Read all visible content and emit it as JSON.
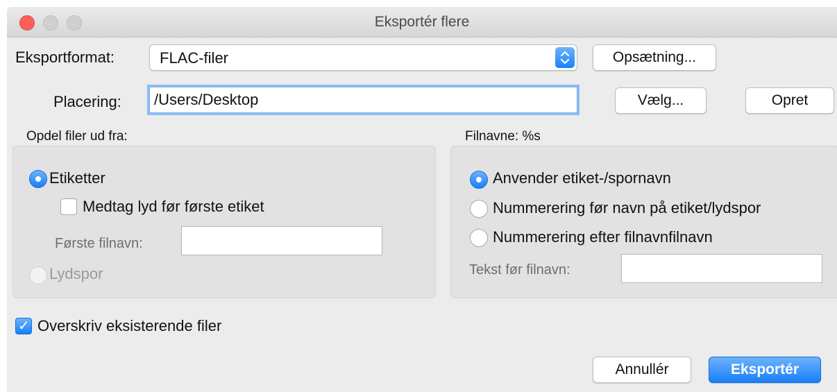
{
  "window": {
    "title": "Eksportér flere"
  },
  "format": {
    "label": "Eksportformat:",
    "value": "FLAC-filer",
    "setup_button": "Opsætning..."
  },
  "location": {
    "label": "Placering:",
    "value": "/Users/Desktop",
    "choose_button": "Vælg...",
    "create_button": "Opret"
  },
  "split": {
    "heading": "Opdel filer ud fra:",
    "labels_option": "Etiketter",
    "include_audio_label": "Medtag lyd før første etiket",
    "first_filename_label": "Første filnavn:",
    "first_filename_value": "",
    "tracks_option": "Lydspor"
  },
  "filenames": {
    "heading": "Filnavne: %s",
    "use_label_name": "Anvender etiket-/spornavn",
    "number_before": "Nummerering før navn på etiket/lydspor",
    "number_after": "Nummerering efter filnavnfilnavn",
    "prefix_label": "Tekst før filnavn:",
    "prefix_value": ""
  },
  "overwrite": {
    "label": "Overskriv eksisterende filer",
    "checked": true
  },
  "buttons": {
    "cancel": "Annullér",
    "export": "Eksportér"
  },
  "colors": {
    "accent": "#1a82fb"
  }
}
